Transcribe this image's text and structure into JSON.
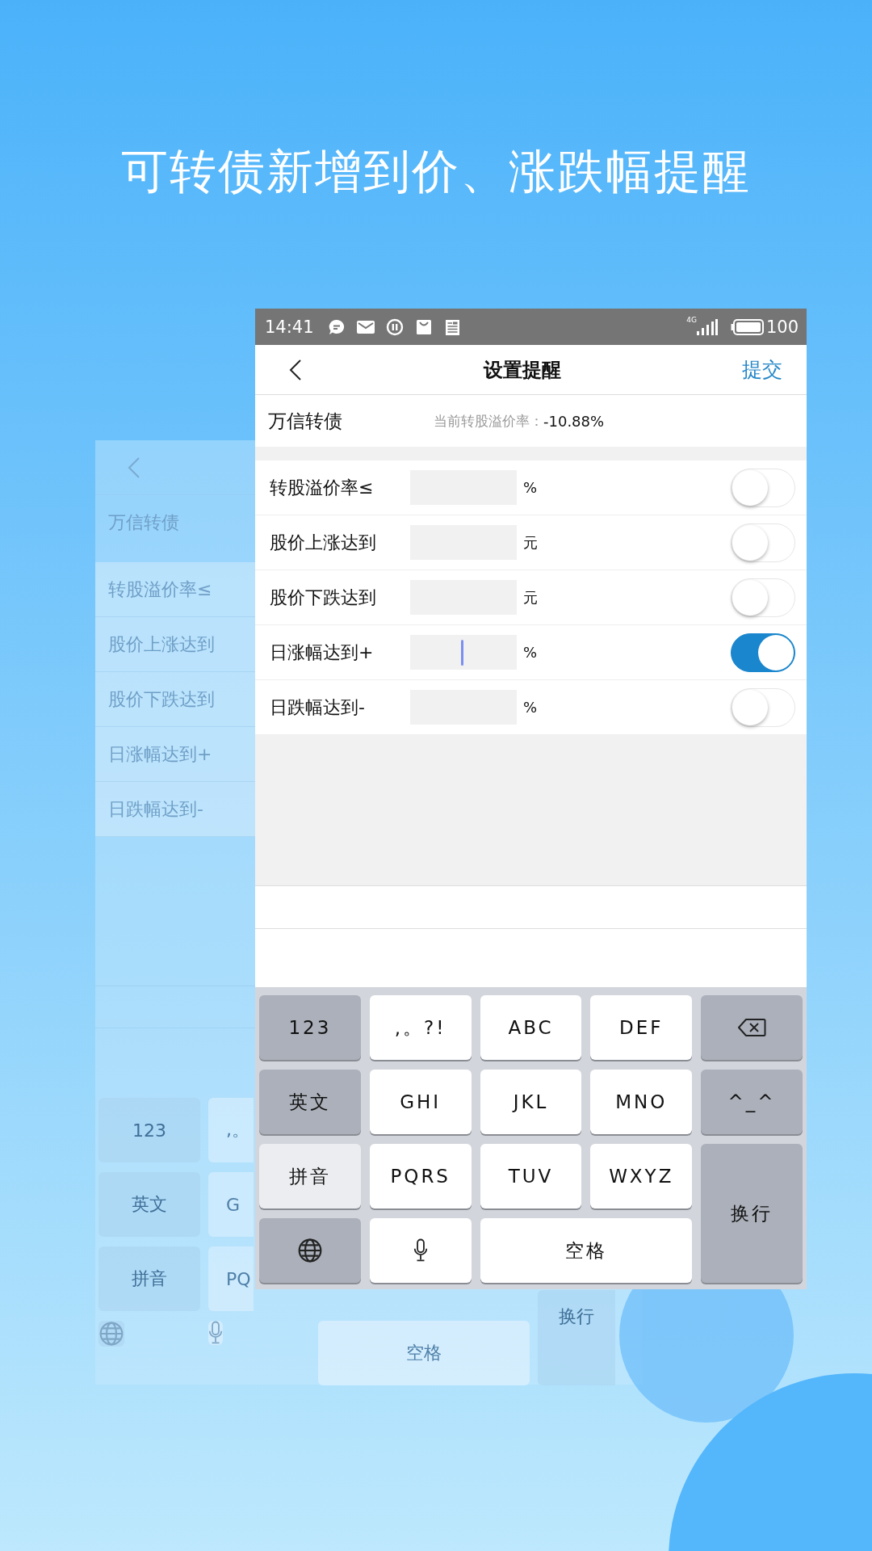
{
  "headline": "可转债新增到价、涨跌幅提醒",
  "background_screen": {
    "bond": "万信转债",
    "rows": [
      "转股溢价率≤",
      "股价上涨达到",
      "股价下跌达到",
      "日涨幅达到+",
      "日跌幅达到-"
    ],
    "key_rows": [
      [
        {
          "label": "123",
          "kind": "function"
        },
        {
          "label": ",。",
          "kind": "char"
        }
      ],
      [
        {
          "label": "英文",
          "kind": "function"
        },
        {
          "label": "G",
          "kind": "char"
        }
      ],
      [
        {
          "label": "拼音",
          "kind": "function"
        },
        {
          "label": "PQ",
          "kind": "char"
        },
        {
          "label": "换行",
          "kind": "enter"
        }
      ],
      [
        {
          "kind": "globe"
        },
        {
          "kind": "mic"
        },
        {
          "label": "空格",
          "kind": "space"
        }
      ]
    ]
  },
  "status_bar": {
    "time": "14:41",
    "network": "4G",
    "battery": "100"
  },
  "nav": {
    "title": "设置提醒",
    "action": "提交"
  },
  "bond": {
    "name": "万信转债",
    "premium_label": "当前转股溢价率：",
    "premium_value": "-10.88%"
  },
  "alerts": [
    {
      "label": "转股溢价率≤",
      "unit": "%",
      "focused": false,
      "on": false
    },
    {
      "label": "股价上涨达到",
      "unit": "元",
      "focused": false,
      "on": false
    },
    {
      "label": "股价下跌达到",
      "unit": "元",
      "focused": false,
      "on": false
    },
    {
      "label": "日涨幅达到+",
      "unit": "%",
      "focused": true,
      "on": true
    },
    {
      "label": "日跌幅达到-",
      "unit": "%",
      "focused": false,
      "on": false
    }
  ],
  "keyboard": [
    {
      "label": "123",
      "kind": "function"
    },
    {
      "label": ",。?!",
      "kind": "char"
    },
    {
      "label": "ABC",
      "kind": "char"
    },
    {
      "label": "DEF",
      "kind": "char"
    },
    {
      "kind": "delete"
    },
    {
      "label": "英文",
      "kind": "function"
    },
    {
      "label": "GHI",
      "kind": "char"
    },
    {
      "label": "JKL",
      "kind": "char"
    },
    {
      "label": "MNO",
      "kind": "char"
    },
    {
      "label": "^_^",
      "kind": "function"
    },
    {
      "label": "拼音",
      "kind": "mode"
    },
    {
      "label": "PQRS",
      "kind": "char"
    },
    {
      "label": "TUV",
      "kind": "char"
    },
    {
      "label": "WXYZ",
      "kind": "char"
    },
    {
      "label": "换行",
      "kind": "enter"
    },
    {
      "kind": "globe"
    },
    {
      "kind": "mic"
    },
    {
      "label": "空格",
      "kind": "space"
    }
  ]
}
